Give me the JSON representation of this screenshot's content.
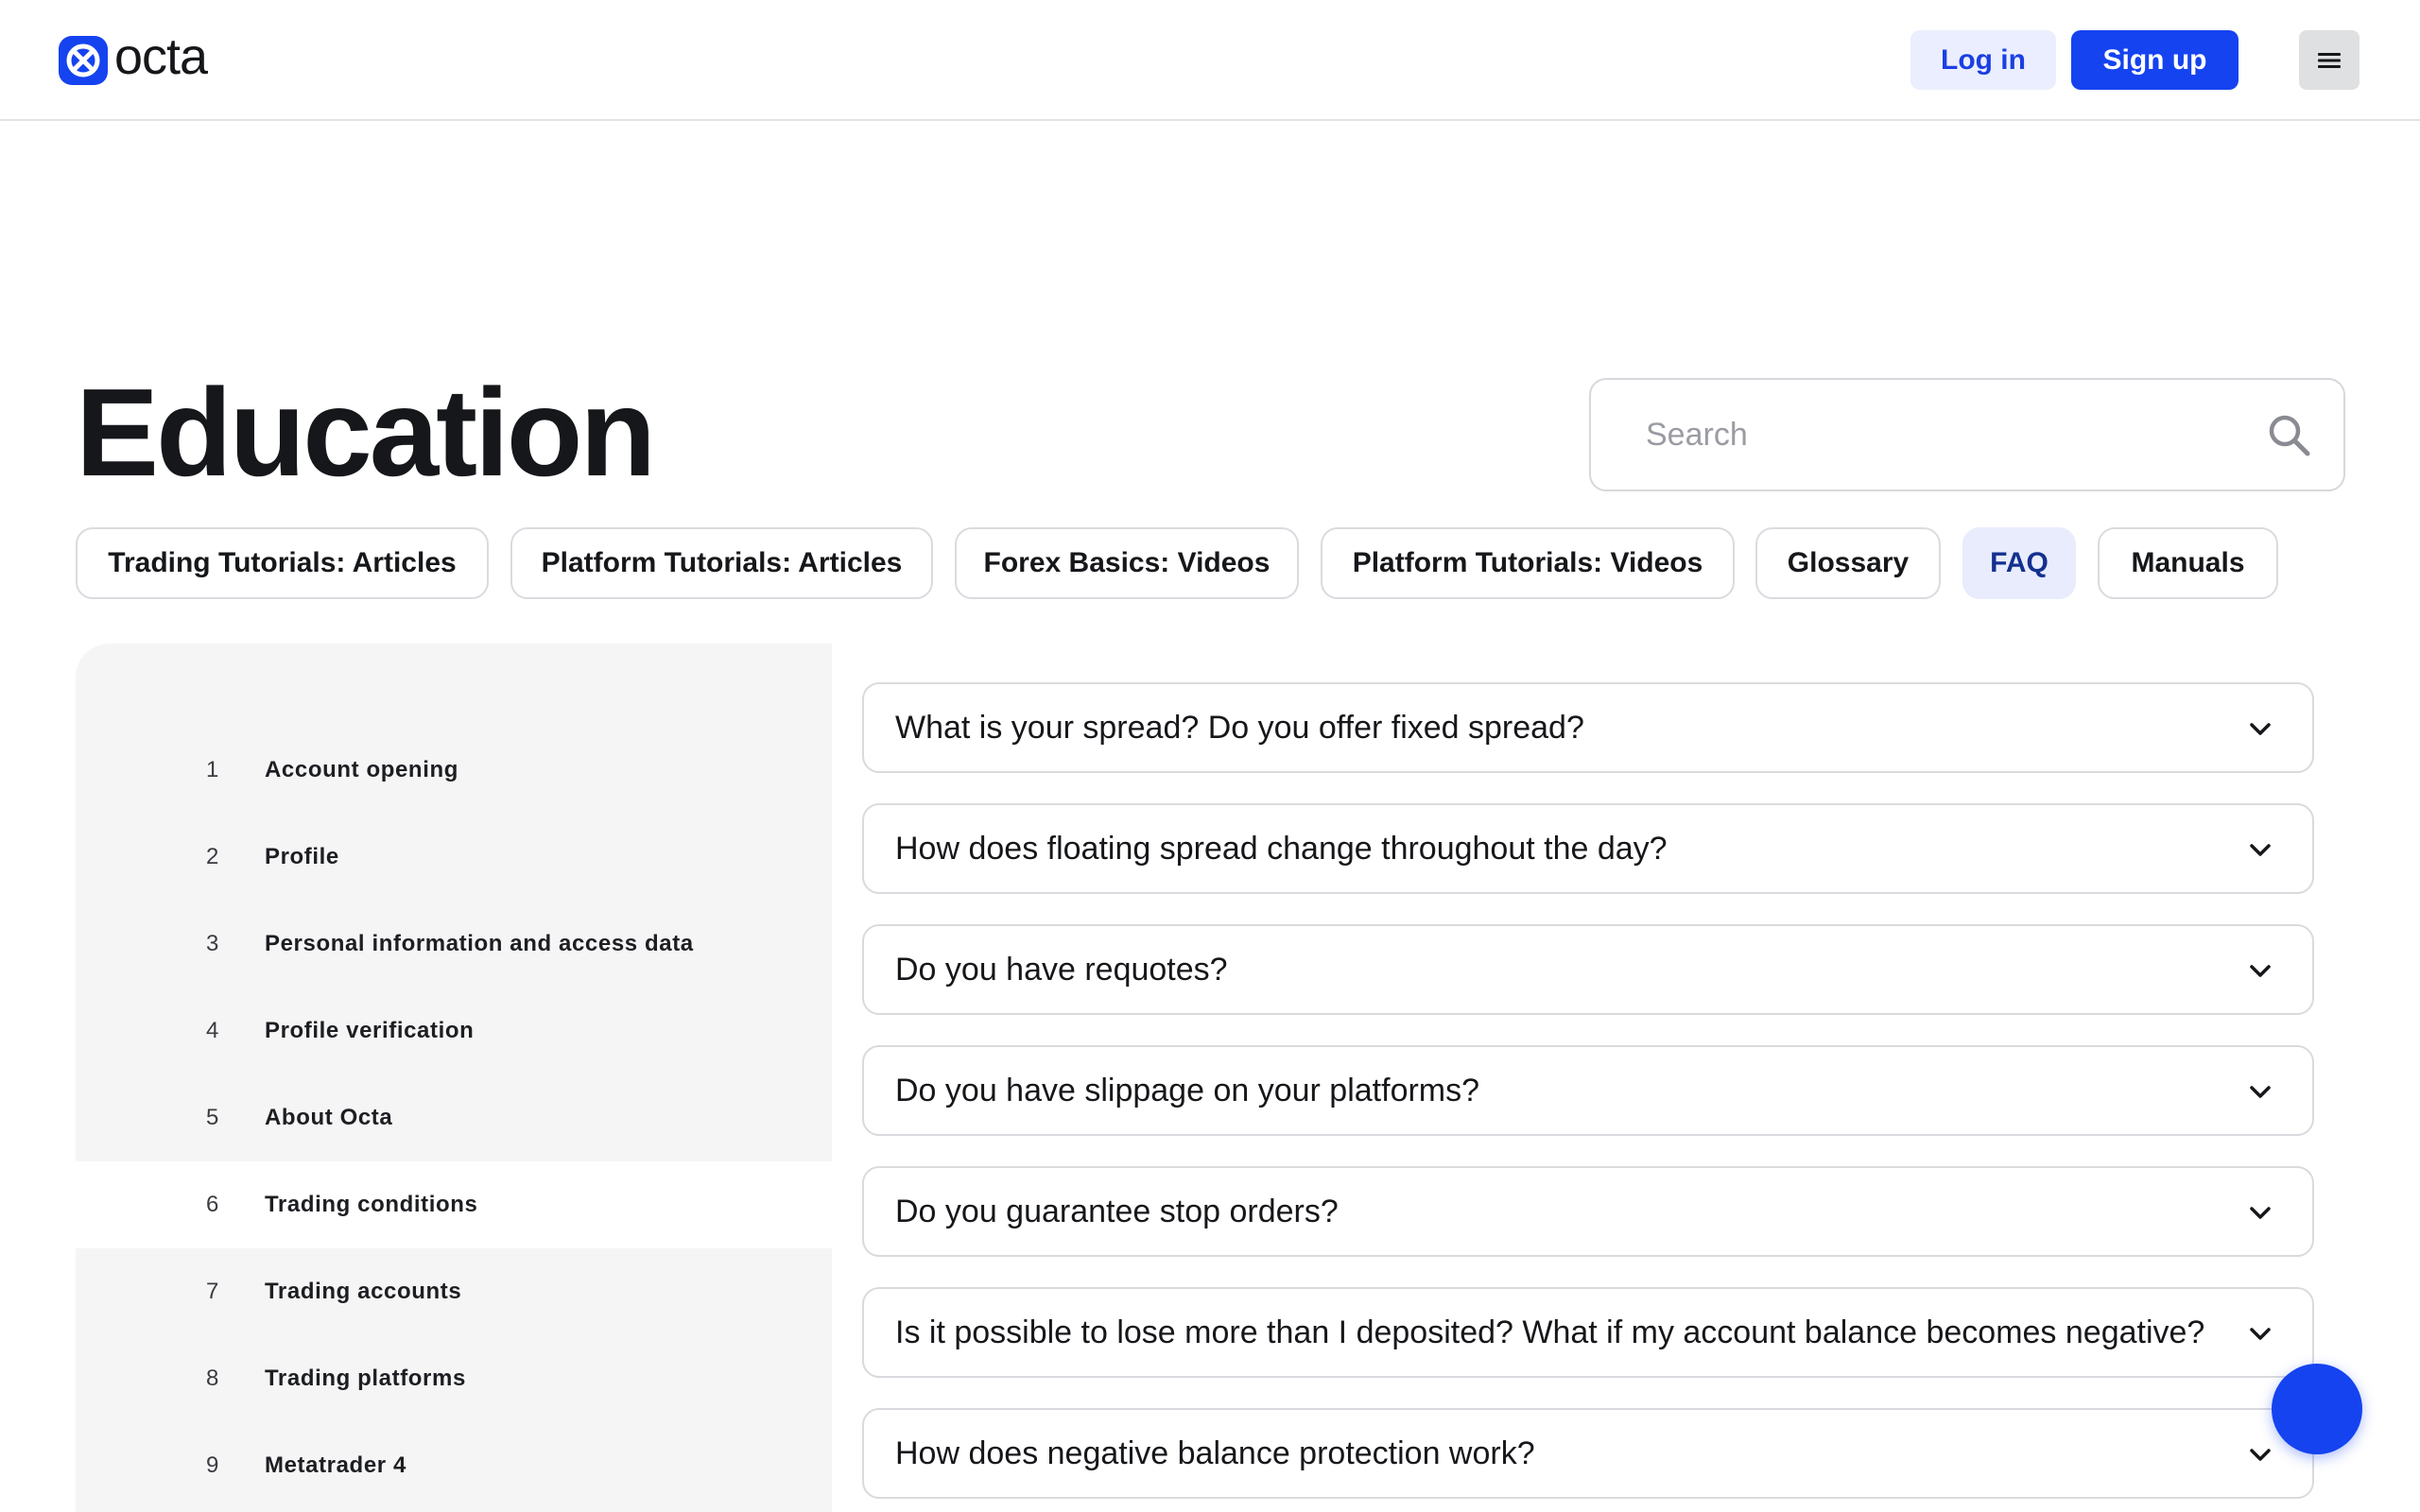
{
  "header": {
    "brand": "octa",
    "login_label": "Log in",
    "signup_label": "Sign up"
  },
  "page": {
    "title": "Education"
  },
  "search": {
    "placeholder": "Search"
  },
  "tabs": [
    {
      "label": "Trading Tutorials: Articles",
      "active": false
    },
    {
      "label": "Platform Tutorials: Articles",
      "active": false
    },
    {
      "label": "Forex Basics: Videos",
      "active": false
    },
    {
      "label": "Platform Tutorials: Videos",
      "active": false
    },
    {
      "label": "Glossary",
      "active": false
    },
    {
      "label": "FAQ",
      "active": true
    },
    {
      "label": "Manuals",
      "active": false
    }
  ],
  "sidebar": {
    "items": [
      {
        "num": "1",
        "label": "Account opening"
      },
      {
        "num": "2",
        "label": "Profile"
      },
      {
        "num": "3",
        "label": "Personal information and access data"
      },
      {
        "num": "4",
        "label": "Profile verification"
      },
      {
        "num": "5",
        "label": "About Octa"
      },
      {
        "num": "6",
        "label": "Trading conditions",
        "active": true
      },
      {
        "num": "7",
        "label": "Trading accounts"
      },
      {
        "num": "8",
        "label": "Trading platforms"
      },
      {
        "num": "9",
        "label": "Metatrader 4"
      }
    ]
  },
  "faq": {
    "items": [
      {
        "question": "What is your spread? Do you offer fixed spread?"
      },
      {
        "question": "How does floating spread change throughout the day?"
      },
      {
        "question": "Do you have requotes?"
      },
      {
        "question": "Do you have slippage on your platforms?"
      },
      {
        "question": "Do you guarantee stop orders?"
      },
      {
        "question": "Is it possible to lose more than I deposited? What if my account balance becomes negative?"
      },
      {
        "question": "How does negative balance protection work?"
      }
    ]
  },
  "colors": {
    "brand_blue": "#1543f0",
    "login_bg": "#eaeefe",
    "active_tab_bg": "#e8ecfd",
    "sidebar_bg": "#f5f5f6"
  },
  "icons": {
    "logo": "octa-logo-icon",
    "menu": "hamburger-icon",
    "search": "search-icon",
    "faq_toggle": "chevron-down-icon"
  }
}
